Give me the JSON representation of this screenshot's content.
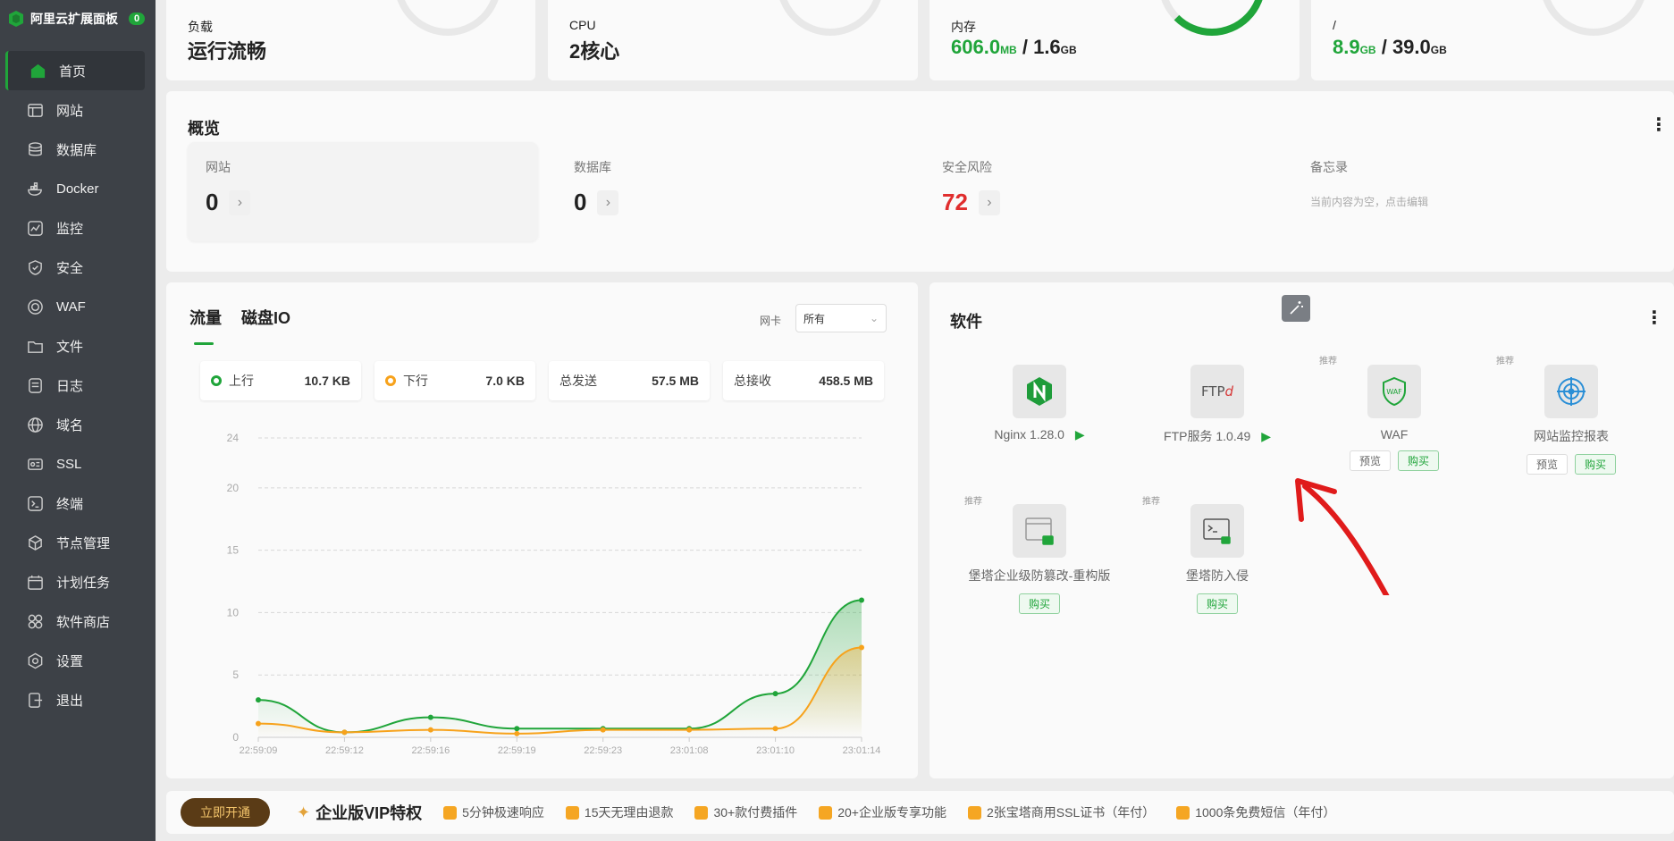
{
  "sidebar": {
    "brand": "阿里云扩展面板",
    "badge": "0",
    "items": [
      {
        "label": "首页",
        "icon": "home-icon"
      },
      {
        "label": "网站",
        "icon": "website-icon"
      },
      {
        "label": "数据库",
        "icon": "database-icon"
      },
      {
        "label": "Docker",
        "icon": "docker-icon"
      },
      {
        "label": "监控",
        "icon": "monitor-icon"
      },
      {
        "label": "安全",
        "icon": "shield-icon"
      },
      {
        "label": "WAF",
        "icon": "waf-icon"
      },
      {
        "label": "文件",
        "icon": "folder-icon"
      },
      {
        "label": "日志",
        "icon": "log-icon"
      },
      {
        "label": "域名",
        "icon": "globe-icon"
      },
      {
        "label": "SSL",
        "icon": "ssl-icon"
      },
      {
        "label": "终端",
        "icon": "terminal-icon"
      },
      {
        "label": "节点管理",
        "icon": "node-icon"
      },
      {
        "label": "计划任务",
        "icon": "calendar-icon"
      },
      {
        "label": "软件商店",
        "icon": "store-icon"
      },
      {
        "label": "设置",
        "icon": "settings-icon"
      },
      {
        "label": "退出",
        "icon": "logout-icon"
      }
    ]
  },
  "stats": {
    "load": {
      "label": "负载",
      "value": "运行流畅"
    },
    "cpu": {
      "label": "CPU",
      "value": "2核心"
    },
    "memory": {
      "label": "内存",
      "used": "606.0",
      "used_unit": "MB",
      "sep": " / ",
      "total": "1.6",
      "total_unit": "GB"
    },
    "disk": {
      "label": "/",
      "used": "8.9",
      "used_unit": "GB",
      "sep": " / ",
      "total": "39.0",
      "total_unit": "GB"
    }
  },
  "overview": {
    "title": "概览",
    "site": {
      "label": "网站",
      "value": "0"
    },
    "db": {
      "label": "数据库",
      "value": "0"
    },
    "risk": {
      "label": "安全风险",
      "value": "72"
    },
    "memo": {
      "label": "备忘录",
      "placeholder": "当前内容为空，点击编辑"
    }
  },
  "traffic": {
    "tabs": [
      "流量",
      "磁盘IO"
    ],
    "nic_label": "网卡",
    "nic_value": "所有",
    "up": {
      "label": "上行",
      "value": "10.7 KB"
    },
    "down": {
      "label": "下行",
      "value": "7.0 KB"
    },
    "sent": {
      "label": "总发送",
      "value": "57.5 MB"
    },
    "recv": {
      "label": "总接收",
      "value": "458.5 MB"
    }
  },
  "chart_data": {
    "type": "line",
    "x": [
      "22:59:09",
      "22:59:12",
      "22:59:16",
      "22:59:19",
      "22:59:23",
      "23:01:08",
      "23:01:10",
      "23:01:14"
    ],
    "series": [
      {
        "name": "上行",
        "color": "#20a53a",
        "values": [
          3.0,
          0.4,
          1.6,
          0.7,
          0.7,
          0.7,
          3.5,
          11.0
        ]
      },
      {
        "name": "下行",
        "color": "#f7a21b",
        "values": [
          1.1,
          0.4,
          0.6,
          0.3,
          0.6,
          0.6,
          0.7,
          7.2
        ]
      }
    ],
    "yticks": [
      0,
      5,
      10,
      15,
      20,
      24
    ],
    "ylim": [
      0,
      24
    ],
    "grid": true
  },
  "software": {
    "title": "软件",
    "recommend": "推荐",
    "preview": "预览",
    "buy": "购买",
    "items": [
      {
        "name": "Nginx 1.28.0"
      },
      {
        "name": "FTP服务 1.0.49"
      },
      {
        "name": "WAF"
      },
      {
        "name": "网站监控报表"
      },
      {
        "name": "堡塔企业级防篡改-重构版"
      },
      {
        "name": "堡塔防入侵"
      }
    ]
  },
  "bottom": {
    "cta": "立即开通",
    "title": "企业版VIP特权",
    "perks": [
      "5分钟极速响应",
      "15天无理由退款",
      "30+款付费插件",
      "20+企业版专享功能",
      "2张宝塔商用SSL证书（年付）",
      "1000条免费短信（年付）"
    ]
  },
  "colors": {
    "accent": "#20a53a",
    "orange": "#f7a21b",
    "danger": "#e02e2e",
    "sidebar": "#3d4147"
  }
}
